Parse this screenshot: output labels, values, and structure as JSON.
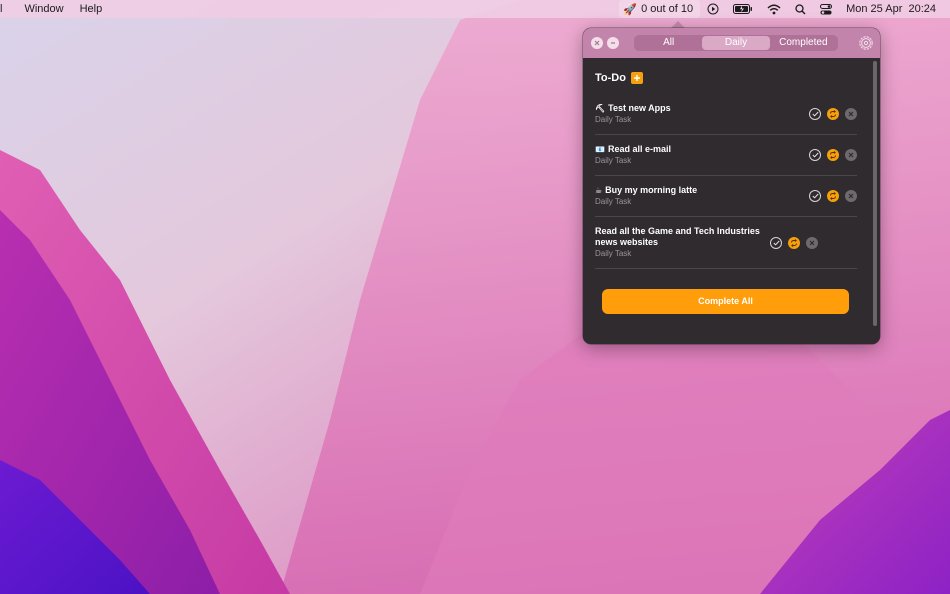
{
  "menubar": {
    "items": [
      "l",
      "Window",
      "Help"
    ],
    "todo_status": "0 out of 10",
    "clock": "Mon 25 Apr  20:24",
    "icons": [
      "rocket-icon",
      "play-circle-icon",
      "battery-icon",
      "wifi-icon",
      "search-icon",
      "control-center-icon"
    ]
  },
  "popover": {
    "tabs": [
      {
        "label": "All",
        "active": false
      },
      {
        "label": "Daily",
        "active": true
      },
      {
        "label": "Completed",
        "active": false
      }
    ],
    "section_title": "To-Do",
    "tasks": [
      {
        "emoji": "⛏",
        "title": "Test new Apps",
        "subtitle": "Daily Task"
      },
      {
        "emoji": "📧",
        "title": "Read all e-mail",
        "subtitle": "Daily Task"
      },
      {
        "emoji": "☕",
        "title": "Buy my morning latte",
        "subtitle": "Daily Task"
      },
      {
        "emoji": "",
        "title": "Read all the Game and Tech Industries news websites",
        "subtitle": "Daily Task"
      }
    ],
    "complete_all_label": "Complete All"
  },
  "colors": {
    "accent": "#ff9d0a",
    "header": "#c384ab",
    "panel": "#2f2b2f"
  }
}
